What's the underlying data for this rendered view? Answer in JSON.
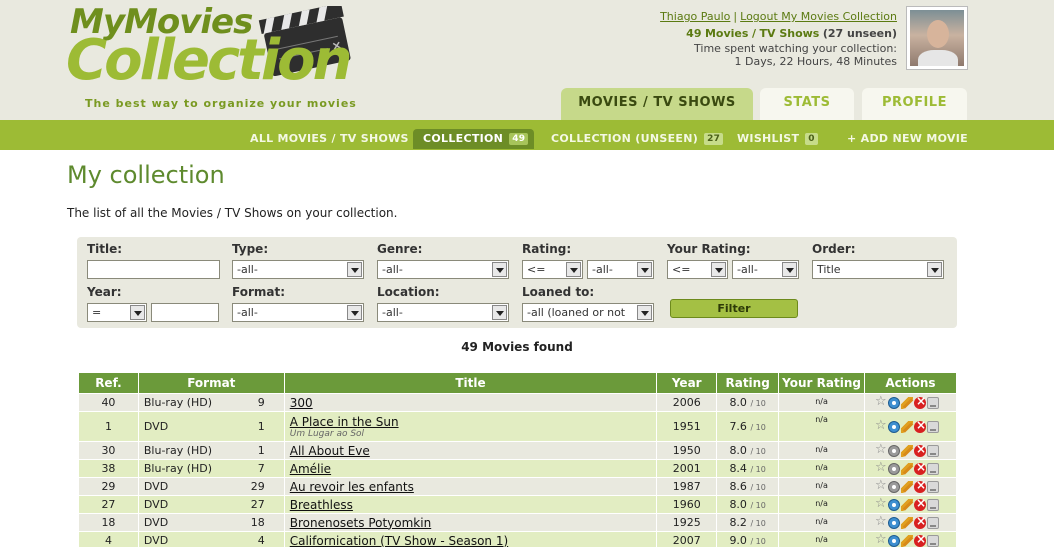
{
  "logo": {
    "line1": "MyMovies",
    "line2": "Collection",
    "tagline": "The best way to organize your movies"
  },
  "user": {
    "name": "Thiago Paulo",
    "logout": "Logout My Movies Collection",
    "movies_count": "49",
    "movies_label": "Movies",
    "tvshows_label": "TV Shows",
    "unseen_text": "(27 unseen)",
    "time_label": "Time spent watching your collection:",
    "time_value": "1 Days, 22 Hours, 48 Minutes"
  },
  "main_tabs": [
    {
      "label": "MOVIES / TV SHOWS",
      "active": true
    },
    {
      "label": "STATS",
      "active": false
    },
    {
      "label": "PROFILE",
      "active": false
    }
  ],
  "subnav": [
    {
      "label": "ALL MOVIES / TV SHOWS",
      "badge": ""
    },
    {
      "label": "COLLECTION",
      "badge": "49",
      "active": true
    },
    {
      "label": "COLLECTION (UNSEEN)",
      "badge": "27"
    },
    {
      "label": "WISHLIST",
      "badge": "0"
    },
    {
      "label": "+ ADD NEW MOVIE",
      "badge": ""
    }
  ],
  "page": {
    "title": "My collection",
    "intro": "The list of all the Movies / TV Shows on your collection."
  },
  "filters": {
    "title_label": "Title:",
    "type_label": "Type:",
    "type_value": "-all-",
    "genre_label": "Genre:",
    "genre_value": "-all-",
    "rating_label": "Rating:",
    "rating_op": "<=",
    "rating_value": "-all-",
    "your_rating_label": "Your Rating:",
    "your_rating_op": "<=",
    "your_rating_value": "-all-",
    "order_label": "Order:",
    "order_value": "Title",
    "year_label": "Year:",
    "year_op": "=",
    "format_label": "Format:",
    "format_value": "-all-",
    "location_label": "Location:",
    "location_value": "-all-",
    "loaned_label": "Loaned to:",
    "loaned_value": "-all (loaned or not",
    "filter_button": "Filter"
  },
  "results": {
    "found_text": "49 Movies found"
  },
  "table": {
    "headers": [
      "Ref.",
      "Format",
      "Title",
      "Year",
      "Rating",
      "Your Rating",
      "Actions"
    ],
    "rows": [
      {
        "ref": "40",
        "format": "Blu-ray (HD)",
        "count": "9",
        "title": "300",
        "subtitle": "",
        "year": "2006",
        "rating": "8.0",
        "of": "/ 10",
        "your": "n/a",
        "seen": true
      },
      {
        "ref": "1",
        "format": "DVD",
        "count": "1",
        "title": "A Place in the Sun",
        "subtitle": "Um Lugar ao Sol",
        "year": "1951",
        "rating": "7.6",
        "of": "/ 10",
        "your": "n/a",
        "seen": true
      },
      {
        "ref": "30",
        "format": "Blu-ray (HD)",
        "count": "1",
        "title": "All About Eve",
        "subtitle": "",
        "year": "1950",
        "rating": "8.0",
        "of": "/ 10",
        "your": "n/a",
        "seen": false
      },
      {
        "ref": "38",
        "format": "Blu-ray (HD)",
        "count": "7",
        "title": "Amélie",
        "subtitle": "",
        "year": "2001",
        "rating": "8.4",
        "of": "/ 10",
        "your": "n/a",
        "seen": false
      },
      {
        "ref": "29",
        "format": "DVD",
        "count": "29",
        "title": "Au revoir les enfants",
        "subtitle": "",
        "year": "1987",
        "rating": "8.6",
        "of": "/ 10",
        "your": "n/a",
        "seen": false
      },
      {
        "ref": "27",
        "format": "DVD",
        "count": "27",
        "title": "Breathless",
        "subtitle": "",
        "year": "1960",
        "rating": "8.0",
        "of": "/ 10",
        "your": "n/a",
        "seen": true
      },
      {
        "ref": "18",
        "format": "DVD",
        "count": "18",
        "title": "Bronenosets Potyomkin",
        "subtitle": "",
        "year": "1925",
        "rating": "8.2",
        "of": "/ 10",
        "your": "n/a",
        "seen": true
      },
      {
        "ref": "4",
        "format": "DVD",
        "count": "4",
        "title": "Californication (TV Show - Season 1)",
        "subtitle": "",
        "year": "2007",
        "rating": "9.0",
        "of": "/ 10",
        "your": "n/a",
        "seen": true
      }
    ]
  },
  "icons": {
    "star": "star-icon",
    "view": "eye-icon",
    "edit": "pencil-icon",
    "delete": "delete-icon",
    "loan": "loan-icon"
  },
  "colors": {
    "brand_green": "#9dbb35",
    "dark_green": "#6b9a3a",
    "header_bg": "#e9e9df"
  }
}
